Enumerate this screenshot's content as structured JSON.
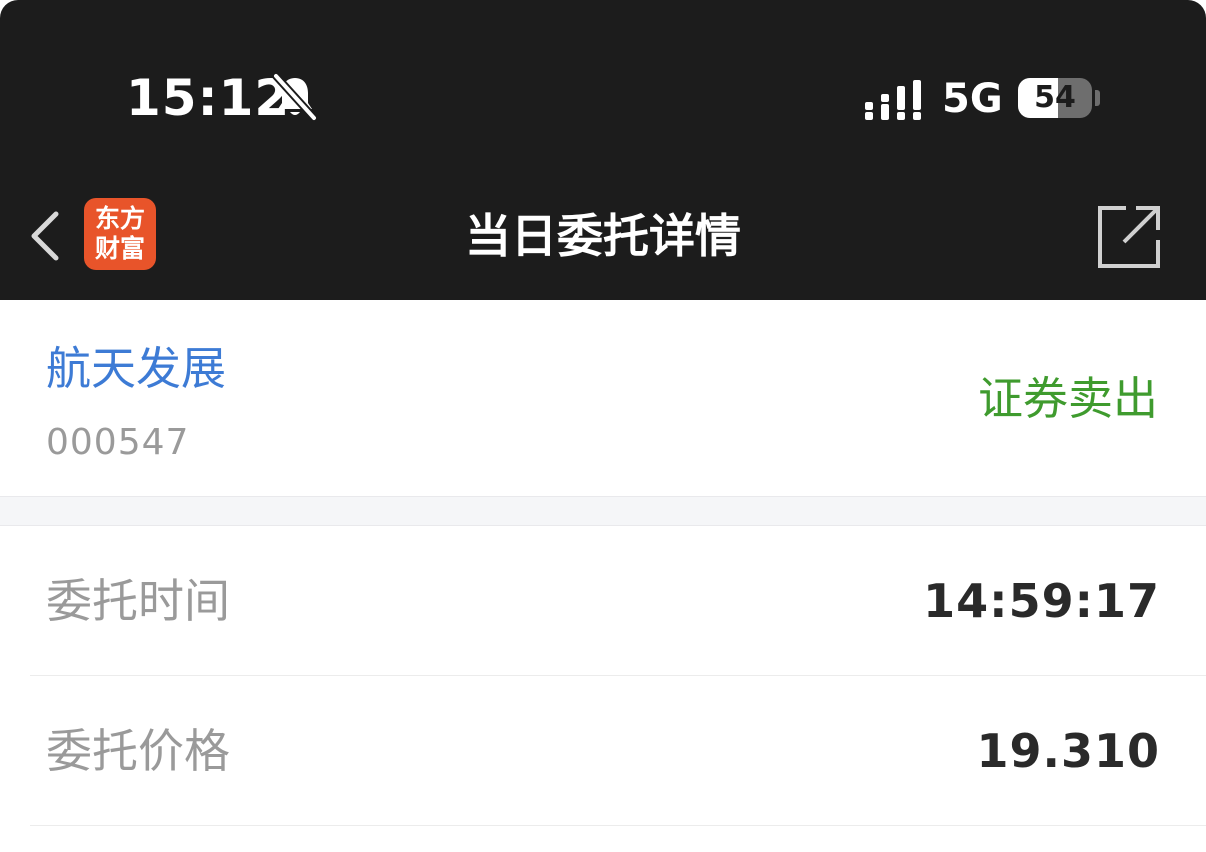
{
  "status_bar": {
    "time": "15:12",
    "network": "5G",
    "battery": "54",
    "battery_level_percent": 54
  },
  "nav": {
    "title": "当日委托详情",
    "logo_line1": "东方",
    "logo_line2": "财富"
  },
  "stock": {
    "name": "航天发展",
    "code": "000547",
    "order_type": "证券卖出"
  },
  "details": {
    "time_label": "委托时间",
    "time_value": "14:59:17",
    "price_label": "委托价格",
    "price_value": "19.310"
  },
  "colors": {
    "header_bg": "#1c1c1c",
    "stock_name": "#3d7bd5",
    "sell": "#3f9b2e",
    "logo_bg": "#e8542a"
  },
  "icons": {
    "back": "chevron-left-icon",
    "silent": "bell-slash-icon",
    "signal": "cellular-signal-icon",
    "share": "share-external-icon"
  }
}
